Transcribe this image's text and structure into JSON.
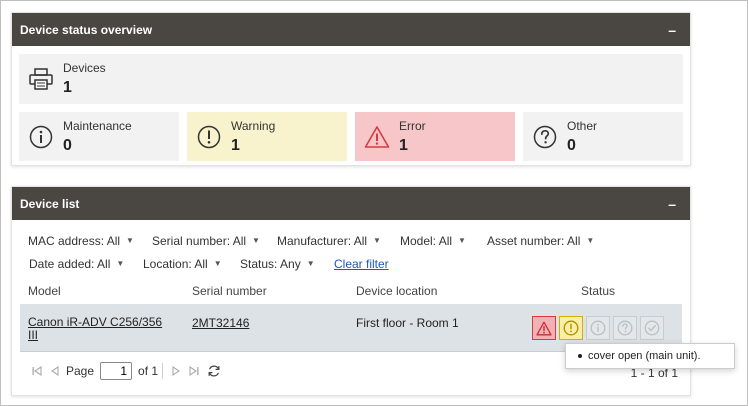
{
  "overview": {
    "title": "Device status overview",
    "collapse": "–",
    "devices": {
      "label": "Devices",
      "count": "1"
    },
    "maintenance": {
      "label": "Maintenance",
      "count": "0"
    },
    "warning": {
      "label": "Warning",
      "count": "1"
    },
    "error": {
      "label": "Error",
      "count": "1"
    },
    "other": {
      "label": "Other",
      "count": "0"
    }
  },
  "list": {
    "title": "Device list",
    "collapse": "–",
    "filters": {
      "mac": "MAC address: All",
      "serial": "Serial number: All",
      "manufacturer": "Manufacturer: All",
      "model": "Model: All",
      "asset": "Asset number: All",
      "date_added": "Date added: All",
      "location": "Location: All",
      "status": "Status: Any",
      "clear": "Clear filter"
    },
    "columns": {
      "model": "Model",
      "serial": "Serial number",
      "location": "Device location",
      "status": "Status"
    },
    "rows": [
      {
        "model": "Canon iR-ADV C256/356 III",
        "serial": "2MT32146",
        "location": "First floor - Room 1"
      }
    ],
    "pager": {
      "page_label": "Page",
      "page_value": "1",
      "of_label": "of 1",
      "range": "1 - 1 of 1"
    },
    "tooltip": "cover open (main unit)."
  },
  "colors": {
    "header_bg": "#4a4743",
    "warning_bg": "#f8f3cd",
    "error_bg": "#f6c6c8",
    "error_icon": "#d63b43",
    "warning_icon": "#b08c00",
    "link": "#1a5bb3"
  }
}
